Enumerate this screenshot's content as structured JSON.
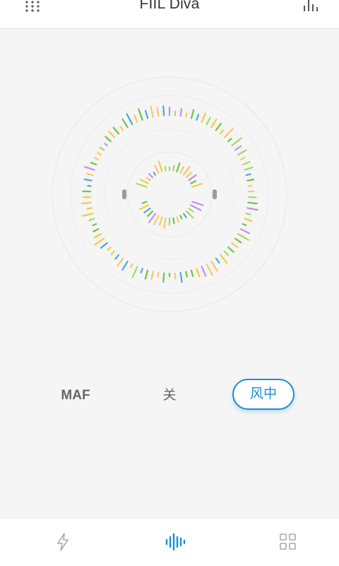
{
  "header": {
    "title": "FIIL Diva",
    "menu_icon": "grid-dots-icon",
    "eq_icon": "equalizer-icon"
  },
  "modes": {
    "items": [
      {
        "label": "MAF",
        "active": false
      },
      {
        "label": "关",
        "active": false
      },
      {
        "label": "风中",
        "active": true
      }
    ]
  },
  "bottom_nav": {
    "items": [
      {
        "icon": "lightning-icon",
        "active": false
      },
      {
        "icon": "sound-wave-icon",
        "active": true
      },
      {
        "icon": "app-grid-icon",
        "active": false
      }
    ]
  },
  "colors": {
    "accent": "#1a8fd1",
    "bar_palette": [
      "#f2c94c",
      "#a6d96a",
      "#6cc644",
      "#c490e4",
      "#4aa9e0",
      "#f7c86b"
    ]
  }
}
